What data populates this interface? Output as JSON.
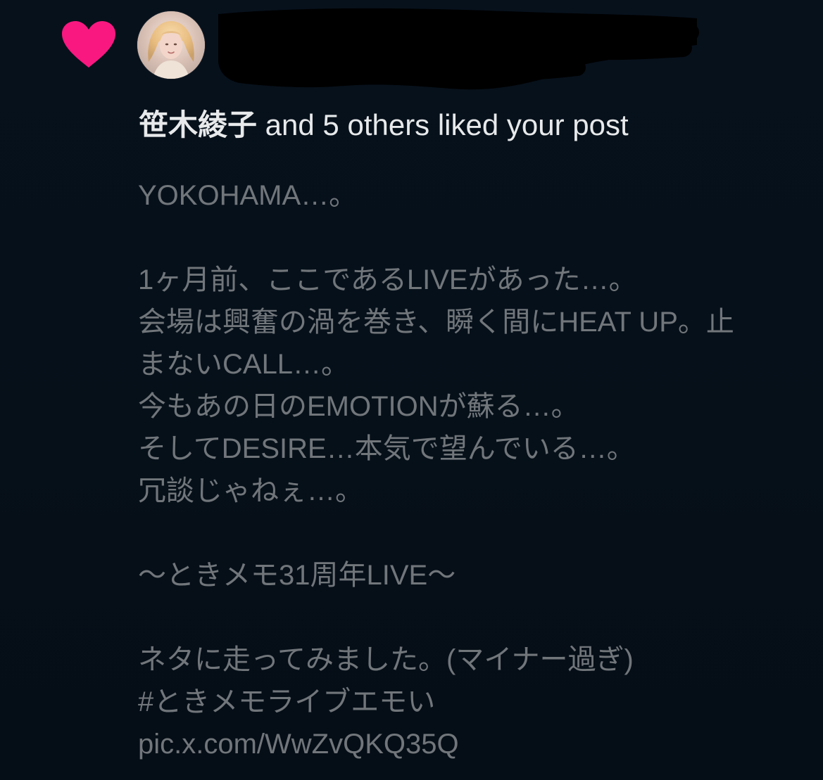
{
  "notification": {
    "type": "like",
    "liker_name": "笹木綾子",
    "action_text": " and 5 others liked your post",
    "icon": "heart-icon",
    "icon_color": "#f91880"
  },
  "avatar": {
    "icon": "avatar"
  },
  "post": {
    "lines": [
      "YOKOHAMA…。",
      "",
      "1ヶ月前、ここであるLIVEがあった…。",
      "会場は興奮の渦を巻き、瞬く間にHEAT UP。止",
      "まないCALL…。",
      "今もあの日のEMOTIONが蘇る…。",
      "そしてDESIRE…本気で望んでいる…。",
      "冗談じゃねぇ…。",
      "",
      "〜ときメモ31周年LIVE〜",
      "",
      "ネタに走ってみました。(マイナー過ぎ)"
    ],
    "hashtag": "#ときメモライブエモい",
    "pic_link": "pic.x.com/WwZvQKQ35Q"
  },
  "colors": {
    "background": "#050d18",
    "primary_text": "#e7e9ea",
    "secondary_text": "#71767b",
    "like_pink": "#f91880"
  }
}
